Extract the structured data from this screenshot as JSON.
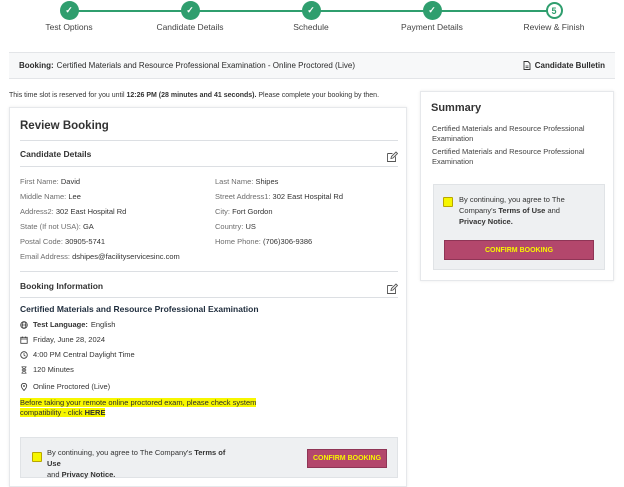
{
  "stepper": {
    "steps": [
      {
        "label": "Test Options",
        "status": "done"
      },
      {
        "label": "Candidate Details",
        "status": "done"
      },
      {
        "label": "Schedule",
        "status": "done"
      },
      {
        "label": "Payment Details",
        "status": "done"
      },
      {
        "label": "Review & Finish",
        "number": "5",
        "status": "current"
      }
    ],
    "check_glyph": "✓"
  },
  "booking": {
    "label": "Booking:",
    "value": "Certified Materials and Resource Professional Examination - Online Proctored (Live)",
    "bulletin_label": "Candidate Bulletin"
  },
  "reservation": {
    "prefix": "This time slot is reserved for you until",
    "time": "12:26 PM (28 minutes and 41 seconds).",
    "suffix": "Please complete your booking by then."
  },
  "review": {
    "title": "Review Booking",
    "candidate_section": "Candidate Details",
    "fields": {
      "first_name": {
        "k": "First Name:",
        "v": "David"
      },
      "last_name": {
        "k": "Last Name:",
        "v": "Shipes"
      },
      "middle_name": {
        "k": "Middle Name:",
        "v": "Lee"
      },
      "street1": {
        "k": "Street Address1:",
        "v": "302 East Hospital Rd"
      },
      "address2": {
        "k": "Address2:",
        "v": "302 East Hospital Rd"
      },
      "city": {
        "k": "City:",
        "v": "Fort Gordon"
      },
      "state": {
        "k": "State (If not USA):",
        "v": "GA"
      },
      "country": {
        "k": "Country:",
        "v": "US"
      },
      "postal": {
        "k": "Postal Code:",
        "v": "30905-5741"
      },
      "phone": {
        "k": "Home Phone:",
        "v": "(706)306-9386"
      },
      "email": {
        "k": "Email Address:",
        "v": "dshipes@facilityservicesinc.com"
      }
    },
    "booking_section": "Booking Information",
    "exam_title": "Certified Materials and Resource Professional Examination",
    "language_label": "Test Language:",
    "language": "English",
    "date": "Friday, June 28, 2024",
    "time": "4:00 PM Central Daylight Time",
    "duration": "120 Minutes",
    "delivery": "Online Proctored (Live)",
    "warning_line1": "Before taking your remote online proctored exam, please check system",
    "warning_line2": "compatibility - click",
    "warning_link": "HERE",
    "agree_prefix": "By continuing, you agree to The Company's",
    "terms": "Terms of Use",
    "and": "and",
    "privacy": "Privacy Notice.",
    "confirm": "CONFIRM BOOKING"
  },
  "summary": {
    "title": "Summary",
    "line1": "Certified Materials and Resource Professional Examination",
    "line2": "Certified Materials and Resource Professional Examination",
    "agree_prefix": "By continuing, you agree to The Company's",
    "terms": "Terms of Use",
    "and": "and",
    "privacy": "Privacy Notice.",
    "confirm": "CONFIRM BOOKING"
  },
  "colors": {
    "step_green": "#2f9e6e",
    "confirm_bg": "#b3476c",
    "confirm_text": "#f6f600",
    "highlight": "#f7f700"
  }
}
